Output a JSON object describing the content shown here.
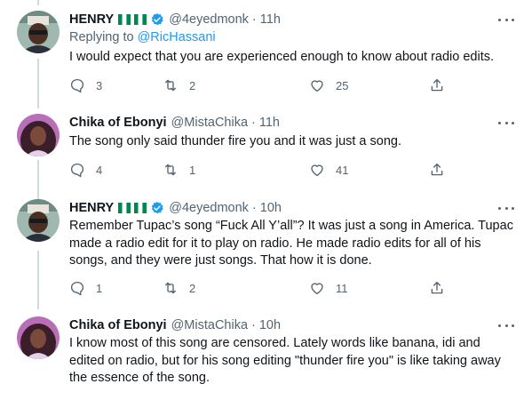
{
  "tweets": [
    {
      "name": "HENRY",
      "handle": "@4eyedmonk",
      "time": "11h",
      "replying_prefix": "Replying to ",
      "replying_to": "@RicHassani",
      "text": "I would expect that you are experienced enough to know about radio edits.",
      "replies": "3",
      "retweets": "2",
      "likes": "25"
    },
    {
      "name": "Chika of Ebonyi",
      "handle": "@MistaChika",
      "time": "11h",
      "text": "The song only said thunder fire you and it was just a song.",
      "replies": "4",
      "retweets": "1",
      "likes": "41"
    },
    {
      "name": "HENRY",
      "handle": "@4eyedmonk",
      "time": "10h",
      "text": "Remember Tupac’s song “Fuck All Y’all”? It was just a song in America. Tupac made a radio edit for it to play on radio. He made radio edits for all of his songs, and they were just songs. That how it is done.",
      "replies": "1",
      "retweets": "2",
      "likes": "11"
    },
    {
      "name": "Chika of Ebonyi",
      "handle": "@MistaChika",
      "time": "10h",
      "text": "I know most of this song are censored. Lately words like banana, idi and edited on radio, but for his song editing \"thunder fire you\" is like taking away the essence of the song."
    }
  ],
  "separator": "·",
  "colors": {
    "accent": "#1d9bf0",
    "secondary_text": "#536471",
    "thread_line": "#cfd9de",
    "flag_green": "#008751"
  },
  "icons": {
    "reply": "reply-icon",
    "retweet": "retweet-icon",
    "like": "heart-icon",
    "share": "share-icon",
    "more": "more-icon",
    "verified": "verified-badge-icon",
    "flag": "nigeria-flag-icon"
  }
}
